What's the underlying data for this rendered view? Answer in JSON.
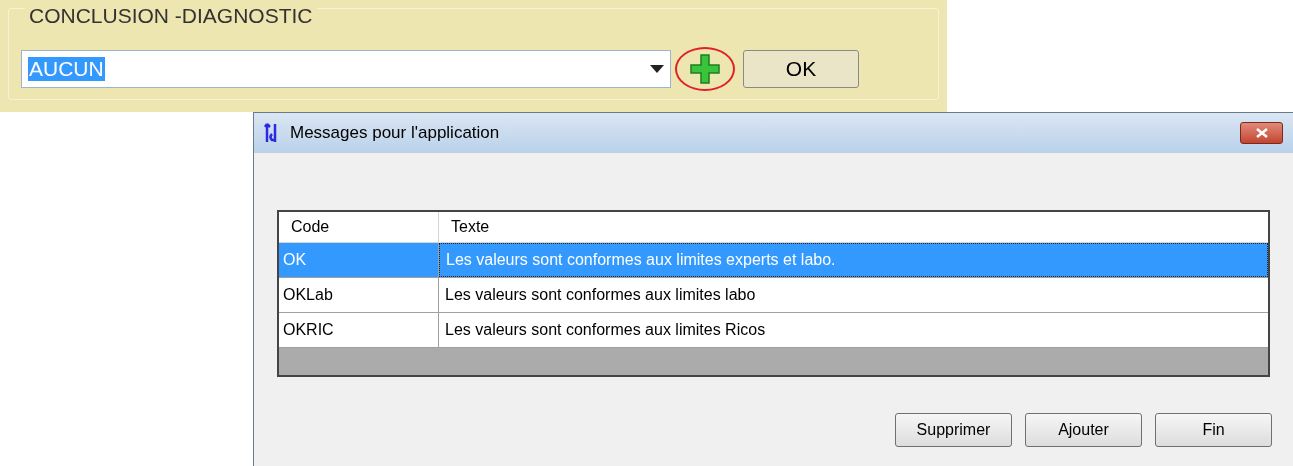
{
  "conclusion_panel": {
    "title": "CONCLUSION -DIAGNOSTIC",
    "combo": {
      "value": "AUCUN",
      "highlighted": true
    },
    "add_button": {
      "circled": true
    },
    "ok_button": "OK"
  },
  "dialog": {
    "title": "Messages pour l'application",
    "table": {
      "columns": [
        "Code",
        "Texte"
      ],
      "rows": [
        {
          "code": "OK",
          "text": "Les valeurs sont conformes aux limites experts et labo.",
          "selected": true
        },
        {
          "code": "OKLab",
          "text": "Les valeurs sont conformes aux limites labo",
          "selected": false
        },
        {
          "code": "OKRIC",
          "text": "Les valeurs sont conformes aux limites Ricos",
          "selected": false
        }
      ]
    },
    "buttons": [
      "Supprimer",
      "Ajouter",
      "Fin"
    ]
  }
}
